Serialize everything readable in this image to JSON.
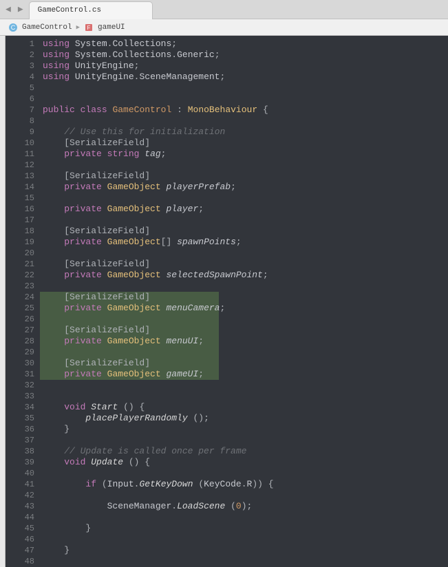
{
  "tab": {
    "label": "GameControl.cs"
  },
  "breadcrumb": {
    "class": "GameControl",
    "member": "gameUI"
  },
  "code": {
    "lines": [
      {
        "n": 1,
        "hl": false,
        "tokens": [
          [
            "kw",
            "using"
          ],
          [
            "txt",
            " "
          ],
          [
            "txt",
            "System"
          ],
          [
            "punc",
            "."
          ],
          [
            "txt",
            "Collections"
          ],
          [
            "punc",
            ";"
          ]
        ]
      },
      {
        "n": 2,
        "hl": false,
        "tokens": [
          [
            "kw",
            "using"
          ],
          [
            "txt",
            " "
          ],
          [
            "txt",
            "System"
          ],
          [
            "punc",
            "."
          ],
          [
            "txt",
            "Collections"
          ],
          [
            "punc",
            "."
          ],
          [
            "txt",
            "Generic"
          ],
          [
            "punc",
            ";"
          ]
        ]
      },
      {
        "n": 3,
        "hl": false,
        "tokens": [
          [
            "kw",
            "using"
          ],
          [
            "txt",
            " "
          ],
          [
            "txt",
            "UnityEngine"
          ],
          [
            "punc",
            ";"
          ]
        ]
      },
      {
        "n": 4,
        "hl": false,
        "tokens": [
          [
            "kw",
            "using"
          ],
          [
            "txt",
            " "
          ],
          [
            "txt",
            "UnityEngine"
          ],
          [
            "punc",
            "."
          ],
          [
            "txt",
            "SceneManagement"
          ],
          [
            "punc",
            ";"
          ]
        ]
      },
      {
        "n": 5,
        "hl": false,
        "tokens": []
      },
      {
        "n": 6,
        "hl": false,
        "tokens": []
      },
      {
        "n": 7,
        "hl": false,
        "tokens": [
          [
            "kw",
            "public"
          ],
          [
            "txt",
            " "
          ],
          [
            "kw",
            "class"
          ],
          [
            "txt",
            " "
          ],
          [
            "cls",
            "GameControl"
          ],
          [
            "txt",
            " "
          ],
          [
            "punc",
            ":"
          ],
          [
            "txt",
            " "
          ],
          [
            "type",
            "MonoBehaviour"
          ],
          [
            "txt",
            " "
          ],
          [
            "punc",
            "{"
          ]
        ]
      },
      {
        "n": 8,
        "hl": false,
        "tokens": []
      },
      {
        "n": 9,
        "hl": false,
        "tokens": [
          [
            "txt",
            "    "
          ],
          [
            "com",
            "// Use this for initialization"
          ]
        ]
      },
      {
        "n": 10,
        "hl": false,
        "tokens": [
          [
            "txt",
            "    "
          ],
          [
            "attr",
            "[SerializeField]"
          ]
        ]
      },
      {
        "n": 11,
        "hl": false,
        "tokens": [
          [
            "txt",
            "    "
          ],
          [
            "kw",
            "private"
          ],
          [
            "txt",
            " "
          ],
          [
            "kw",
            "string"
          ],
          [
            "txt",
            " "
          ],
          [
            "ident",
            "tag"
          ],
          [
            "punc",
            ";"
          ]
        ]
      },
      {
        "n": 12,
        "hl": false,
        "tokens": []
      },
      {
        "n": 13,
        "hl": false,
        "tokens": [
          [
            "txt",
            "    "
          ],
          [
            "attr",
            "[SerializeField]"
          ]
        ]
      },
      {
        "n": 14,
        "hl": false,
        "tokens": [
          [
            "txt",
            "    "
          ],
          [
            "kw",
            "private"
          ],
          [
            "txt",
            " "
          ],
          [
            "type",
            "GameObject"
          ],
          [
            "txt",
            " "
          ],
          [
            "ident",
            "playerPrefab"
          ],
          [
            "punc",
            ";"
          ]
        ]
      },
      {
        "n": 15,
        "hl": false,
        "tokens": []
      },
      {
        "n": 16,
        "hl": false,
        "tokens": [
          [
            "txt",
            "    "
          ],
          [
            "kw",
            "private"
          ],
          [
            "txt",
            " "
          ],
          [
            "type",
            "GameObject"
          ],
          [
            "txt",
            " "
          ],
          [
            "ident",
            "player"
          ],
          [
            "punc",
            ";"
          ]
        ]
      },
      {
        "n": 17,
        "hl": false,
        "tokens": []
      },
      {
        "n": 18,
        "hl": false,
        "tokens": [
          [
            "txt",
            "    "
          ],
          [
            "attr",
            "[SerializeField]"
          ]
        ]
      },
      {
        "n": 19,
        "hl": false,
        "tokens": [
          [
            "txt",
            "    "
          ],
          [
            "kw",
            "private"
          ],
          [
            "txt",
            " "
          ],
          [
            "type",
            "GameObject"
          ],
          [
            "punc",
            "[]"
          ],
          [
            "txt",
            " "
          ],
          [
            "ident",
            "spawnPoints"
          ],
          [
            "punc",
            ";"
          ]
        ]
      },
      {
        "n": 20,
        "hl": false,
        "tokens": []
      },
      {
        "n": 21,
        "hl": false,
        "tokens": [
          [
            "txt",
            "    "
          ],
          [
            "attr",
            "[SerializeField]"
          ]
        ]
      },
      {
        "n": 22,
        "hl": false,
        "tokens": [
          [
            "txt",
            "    "
          ],
          [
            "kw",
            "private"
          ],
          [
            "txt",
            " "
          ],
          [
            "type",
            "GameObject"
          ],
          [
            "txt",
            " "
          ],
          [
            "ident",
            "selectedSpawnPoint"
          ],
          [
            "punc",
            ";"
          ]
        ]
      },
      {
        "n": 23,
        "hl": false,
        "tokens": []
      },
      {
        "n": 24,
        "hl": true,
        "tokens": [
          [
            "txt",
            "    "
          ],
          [
            "attr",
            "[SerializeField]"
          ]
        ]
      },
      {
        "n": 25,
        "hl": true,
        "tokens": [
          [
            "txt",
            "    "
          ],
          [
            "kw",
            "private"
          ],
          [
            "txt",
            " "
          ],
          [
            "type",
            "GameObject"
          ],
          [
            "txt",
            " "
          ],
          [
            "ident",
            "menuCamera"
          ],
          [
            "punc",
            ";"
          ]
        ]
      },
      {
        "n": 26,
        "hl": true,
        "tokens": []
      },
      {
        "n": 27,
        "hl": true,
        "tokens": [
          [
            "txt",
            "    "
          ],
          [
            "attr",
            "[SerializeField]"
          ]
        ]
      },
      {
        "n": 28,
        "hl": true,
        "tokens": [
          [
            "txt",
            "    "
          ],
          [
            "kw",
            "private"
          ],
          [
            "txt",
            " "
          ],
          [
            "type",
            "GameObject"
          ],
          [
            "txt",
            " "
          ],
          [
            "ident",
            "menuUI"
          ],
          [
            "punc",
            ";"
          ]
        ]
      },
      {
        "n": 29,
        "hl": true,
        "tokens": []
      },
      {
        "n": 30,
        "hl": true,
        "tokens": [
          [
            "txt",
            "    "
          ],
          [
            "attr",
            "[SerializeField]"
          ]
        ]
      },
      {
        "n": 31,
        "hl": true,
        "tokens": [
          [
            "txt",
            "    "
          ],
          [
            "kw",
            "private"
          ],
          [
            "txt",
            " "
          ],
          [
            "type",
            "GameObject"
          ],
          [
            "txt",
            " "
          ],
          [
            "ident",
            "gameUI"
          ],
          [
            "punc",
            ";"
          ]
        ]
      },
      {
        "n": 32,
        "hl": false,
        "tokens": []
      },
      {
        "n": 33,
        "hl": false,
        "tokens": []
      },
      {
        "n": 34,
        "hl": false,
        "tokens": [
          [
            "txt",
            "    "
          ],
          [
            "kw",
            "void"
          ],
          [
            "txt",
            " "
          ],
          [
            "fn",
            "Start"
          ],
          [
            "txt",
            " "
          ],
          [
            "punc",
            "()"
          ],
          [
            "txt",
            " "
          ],
          [
            "punc",
            "{"
          ]
        ]
      },
      {
        "n": 35,
        "hl": false,
        "tokens": [
          [
            "txt",
            "        "
          ],
          [
            "fn",
            "placePlayerRandomly"
          ],
          [
            "txt",
            " "
          ],
          [
            "punc",
            "();"
          ]
        ]
      },
      {
        "n": 36,
        "hl": false,
        "tokens": [
          [
            "txt",
            "    "
          ],
          [
            "punc",
            "}"
          ]
        ]
      },
      {
        "n": 37,
        "hl": false,
        "tokens": []
      },
      {
        "n": 38,
        "hl": false,
        "tokens": [
          [
            "txt",
            "    "
          ],
          [
            "com",
            "// Update is called once per frame"
          ]
        ]
      },
      {
        "n": 39,
        "hl": false,
        "tokens": [
          [
            "txt",
            "    "
          ],
          [
            "kw",
            "void"
          ],
          [
            "txt",
            " "
          ],
          [
            "fn",
            "Update"
          ],
          [
            "txt",
            " "
          ],
          [
            "punc",
            "()"
          ],
          [
            "txt",
            " "
          ],
          [
            "punc",
            "{"
          ]
        ]
      },
      {
        "n": 40,
        "hl": false,
        "tokens": []
      },
      {
        "n": 41,
        "hl": false,
        "tokens": [
          [
            "txt",
            "        "
          ],
          [
            "kw",
            "if"
          ],
          [
            "txt",
            " "
          ],
          [
            "punc",
            "("
          ],
          [
            "ident2",
            "Input"
          ],
          [
            "punc",
            "."
          ],
          [
            "fn",
            "GetKeyDown"
          ],
          [
            "txt",
            " "
          ],
          [
            "punc",
            "("
          ],
          [
            "ident2",
            "KeyCode"
          ],
          [
            "punc",
            "."
          ],
          [
            "ident2",
            "R"
          ],
          [
            "punc",
            "))"
          ],
          [
            "txt",
            " "
          ],
          [
            "punc",
            "{"
          ]
        ]
      },
      {
        "n": 42,
        "hl": false,
        "tokens": []
      },
      {
        "n": 43,
        "hl": false,
        "tokens": [
          [
            "txt",
            "            "
          ],
          [
            "ident2",
            "SceneManager"
          ],
          [
            "punc",
            "."
          ],
          [
            "fn",
            "LoadScene"
          ],
          [
            "txt",
            " "
          ],
          [
            "punc",
            "("
          ],
          [
            "num",
            "0"
          ],
          [
            "punc",
            ");"
          ]
        ]
      },
      {
        "n": 44,
        "hl": false,
        "tokens": []
      },
      {
        "n": 45,
        "hl": false,
        "tokens": [
          [
            "txt",
            "        "
          ],
          [
            "punc",
            "}"
          ]
        ]
      },
      {
        "n": 46,
        "hl": false,
        "tokens": []
      },
      {
        "n": 47,
        "hl": false,
        "tokens": [
          [
            "txt",
            "    "
          ],
          [
            "punc",
            "}"
          ]
        ]
      },
      {
        "n": 48,
        "hl": false,
        "tokens": []
      }
    ]
  }
}
